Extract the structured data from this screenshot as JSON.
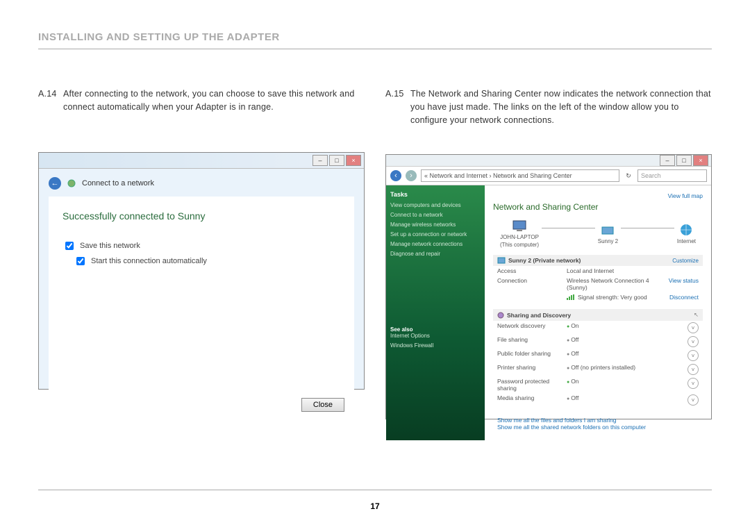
{
  "page": {
    "title": "INSTALLING AND SETTING UP THE ADAPTER",
    "number": "17"
  },
  "stepA": {
    "num": "A.14",
    "text": "After connecting to the network, you can choose to save this network and connect automatically when your Adapter is in range."
  },
  "stepB": {
    "num": "A.15",
    "text": "The Network and Sharing Center now indicates the network connection that you have just made. The links on the left of the window allow you to configure your network connections."
  },
  "dialogA": {
    "bar_title": "Connect to a network",
    "success": "Successfully connected to Sunny",
    "save_checkbox": "Save this network",
    "auto_checkbox": "Start this connection automatically",
    "close": "Close"
  },
  "dialogB": {
    "breadcrumb": "« Network and Internet  ›  Network and Sharing Center",
    "search_placeholder": "Search",
    "tasks_title": "Tasks",
    "tasks": [
      "View computers and devices",
      "Connect to a network",
      "Manage wireless networks",
      "Set up a connection or network",
      "Manage network connections",
      "Diagnose and repair"
    ],
    "see_also_title": "See also",
    "see_also": [
      "Internet Options",
      "Windows Firewall"
    ],
    "nsc_title": "Network and Sharing Center",
    "view_map": "View full map",
    "map": {
      "this_pc": "JOHN-LAPTOP",
      "this_pc_sub": "(This computer)",
      "network": "Sunny 2",
      "internet": "Internet"
    },
    "network_section": "Sunny 2 (Private network)",
    "customize": "Customize",
    "rows": {
      "access_k": "Access",
      "access_v": "Local and Internet",
      "conn_k": "Connection",
      "conn_v": "Wireless Network Connection 4 (Sunny)",
      "conn_link": "View status",
      "signal_k": "",
      "signal_v": "Signal strength: Very good",
      "signal_link": "Disconnect"
    },
    "sharing_title": "Sharing and Discovery",
    "sharing": [
      {
        "k": "Network discovery",
        "v": "On"
      },
      {
        "k": "File sharing",
        "v": "Off"
      },
      {
        "k": "Public folder sharing",
        "v": "Off"
      },
      {
        "k": "Printer sharing",
        "v": "Off (no printers installed)"
      },
      {
        "k": "Password protected sharing",
        "v": "On"
      },
      {
        "k": "Media sharing",
        "v": "Off"
      }
    ],
    "footer1": "Show me all the files and folders I am sharing",
    "footer2": "Show me all the shared network folders on this computer"
  }
}
